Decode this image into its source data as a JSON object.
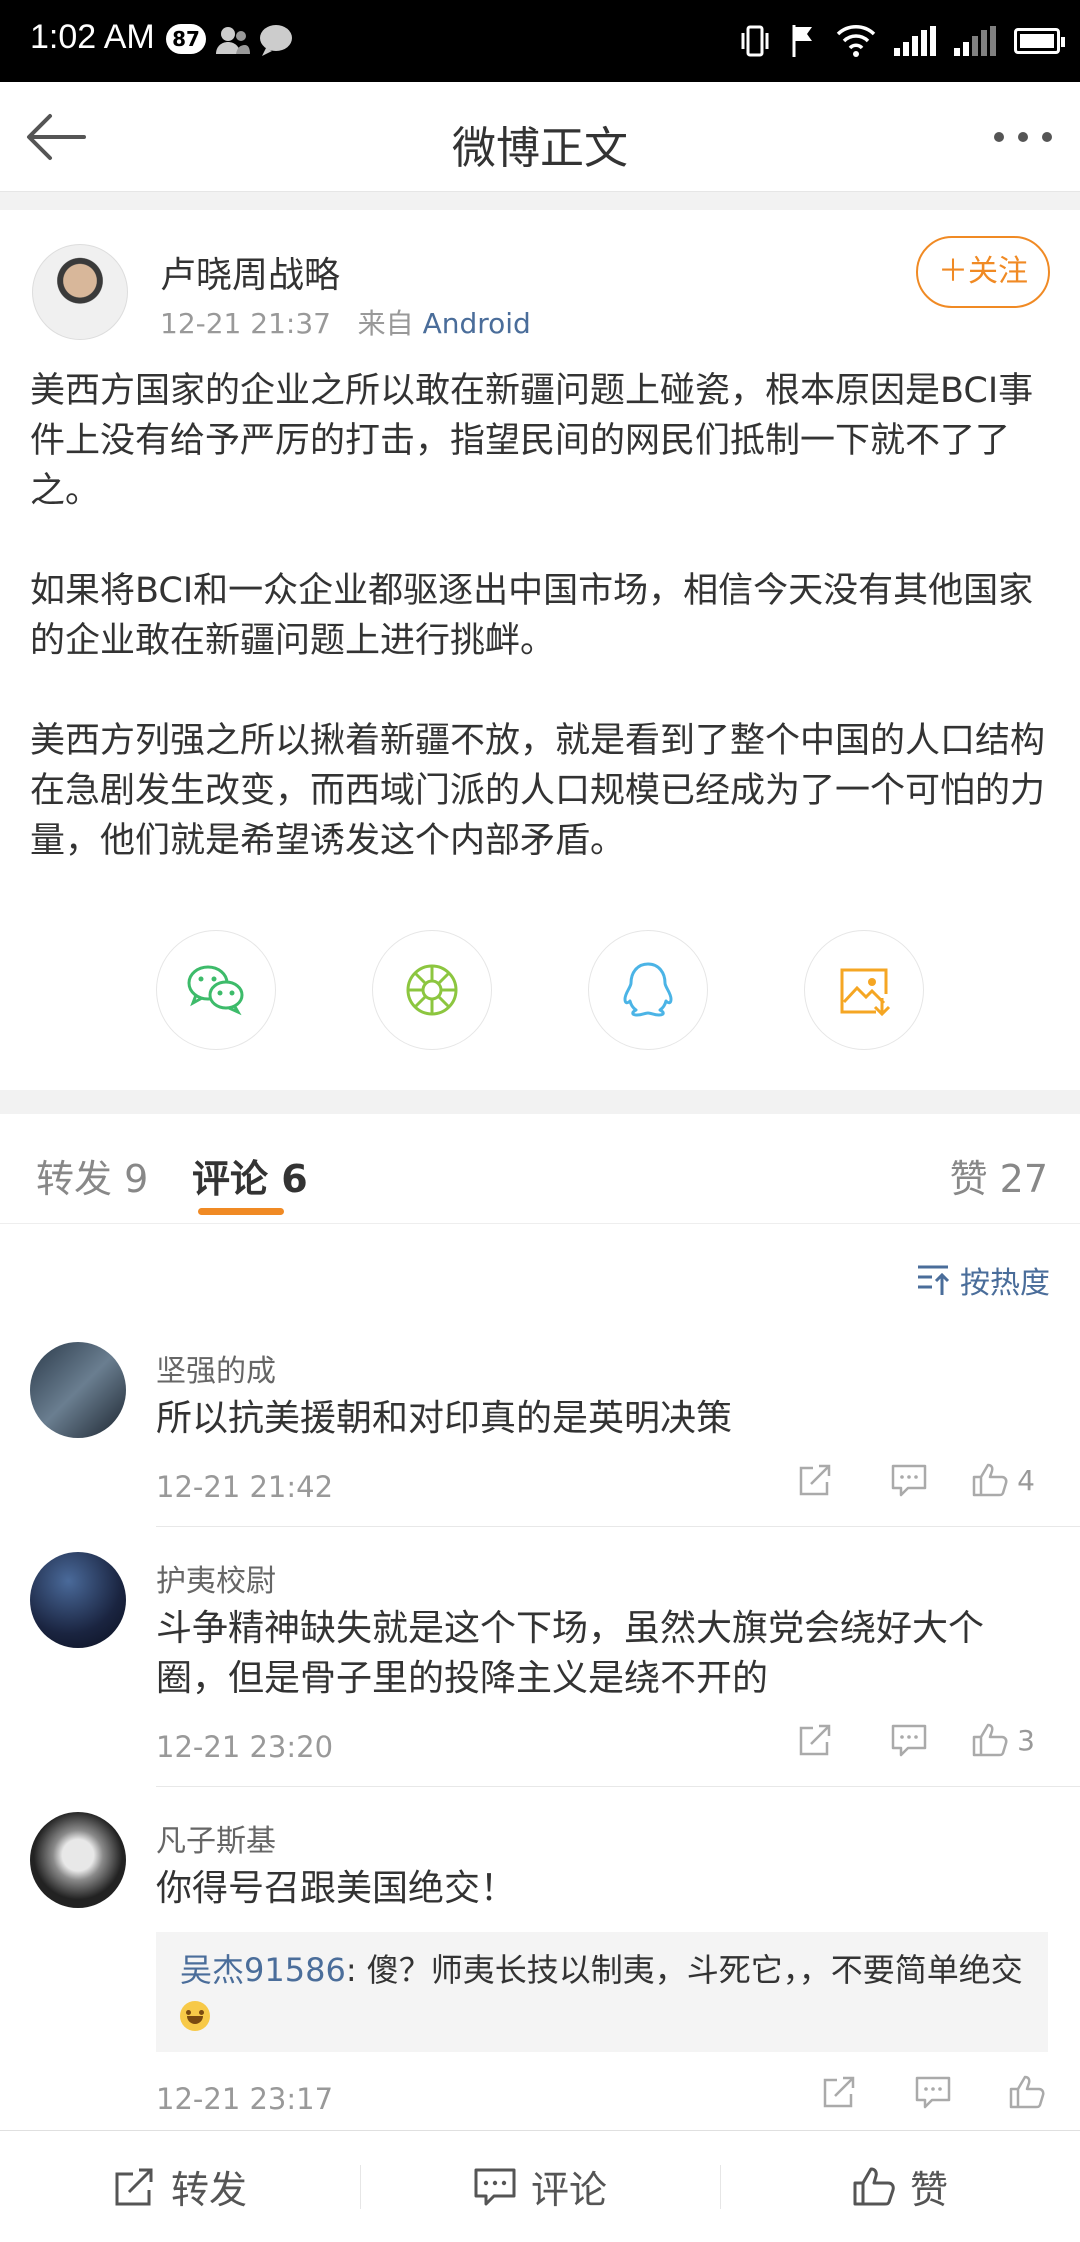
{
  "status_bar": {
    "time": "1:02 AM",
    "notification_count": "87"
  },
  "nav": {
    "title": "微博正文"
  },
  "post": {
    "author": "卢晓周战略",
    "time": "12-21 21:37",
    "source_prefix": "来自",
    "source": "Android",
    "follow_label": "＋关注",
    "paragraphs": [
      "美西方国家的企业之所以敢在新疆问题上碰瓷，根本原因是BCI事件上没有给予严厉的打击，指望民间的网民们抵制一下就不了了之。",
      "如果将BCI和一众企业都驱逐出中国市场，相信今天没有其他国家的企业敢在新疆问题上进行挑衅。",
      "美西方列强之所以揪着新疆不放，就是看到了整个中国的人口结构在急剧发生改变，而西域门派的人口规模已经成为了一个可怕的力量，他们就是希望诱发这个内部矛盾。"
    ]
  },
  "share": {
    "icons": [
      "wechat-icon",
      "moments-icon",
      "qq-icon",
      "save-image-icon"
    ]
  },
  "tabs": {
    "repost": "转发 9",
    "comments": "评论 6",
    "likes": "赞 27"
  },
  "sort_label": "按热度",
  "comments": [
    {
      "name": "坚强的成",
      "text": "所以抗美援朝和对印真的是英明决策",
      "time": "12-21 21:42",
      "like_count": "4"
    },
    {
      "name": "护夷校尉",
      "text": "斗争精神缺失就是这个下场，虽然大旗党会绕好大个圈，但是骨子里的投降主义是绕不开的",
      "time": "12-21 23:20",
      "like_count": "3"
    },
    {
      "name": "凡子斯基",
      "text": "你得号召跟美国绝交！",
      "time": "12-21 23:17",
      "like_count": "",
      "reply": {
        "user": "吴杰91586",
        "text": ": 傻？师夷长技以制夷，斗死它，，不要简单绝交"
      }
    }
  ],
  "bottom_bar": {
    "repost": "转发",
    "comment": "评论",
    "like": "赞"
  },
  "colors": {
    "accent": "#f08a24",
    "link": "#4a6d9a"
  }
}
